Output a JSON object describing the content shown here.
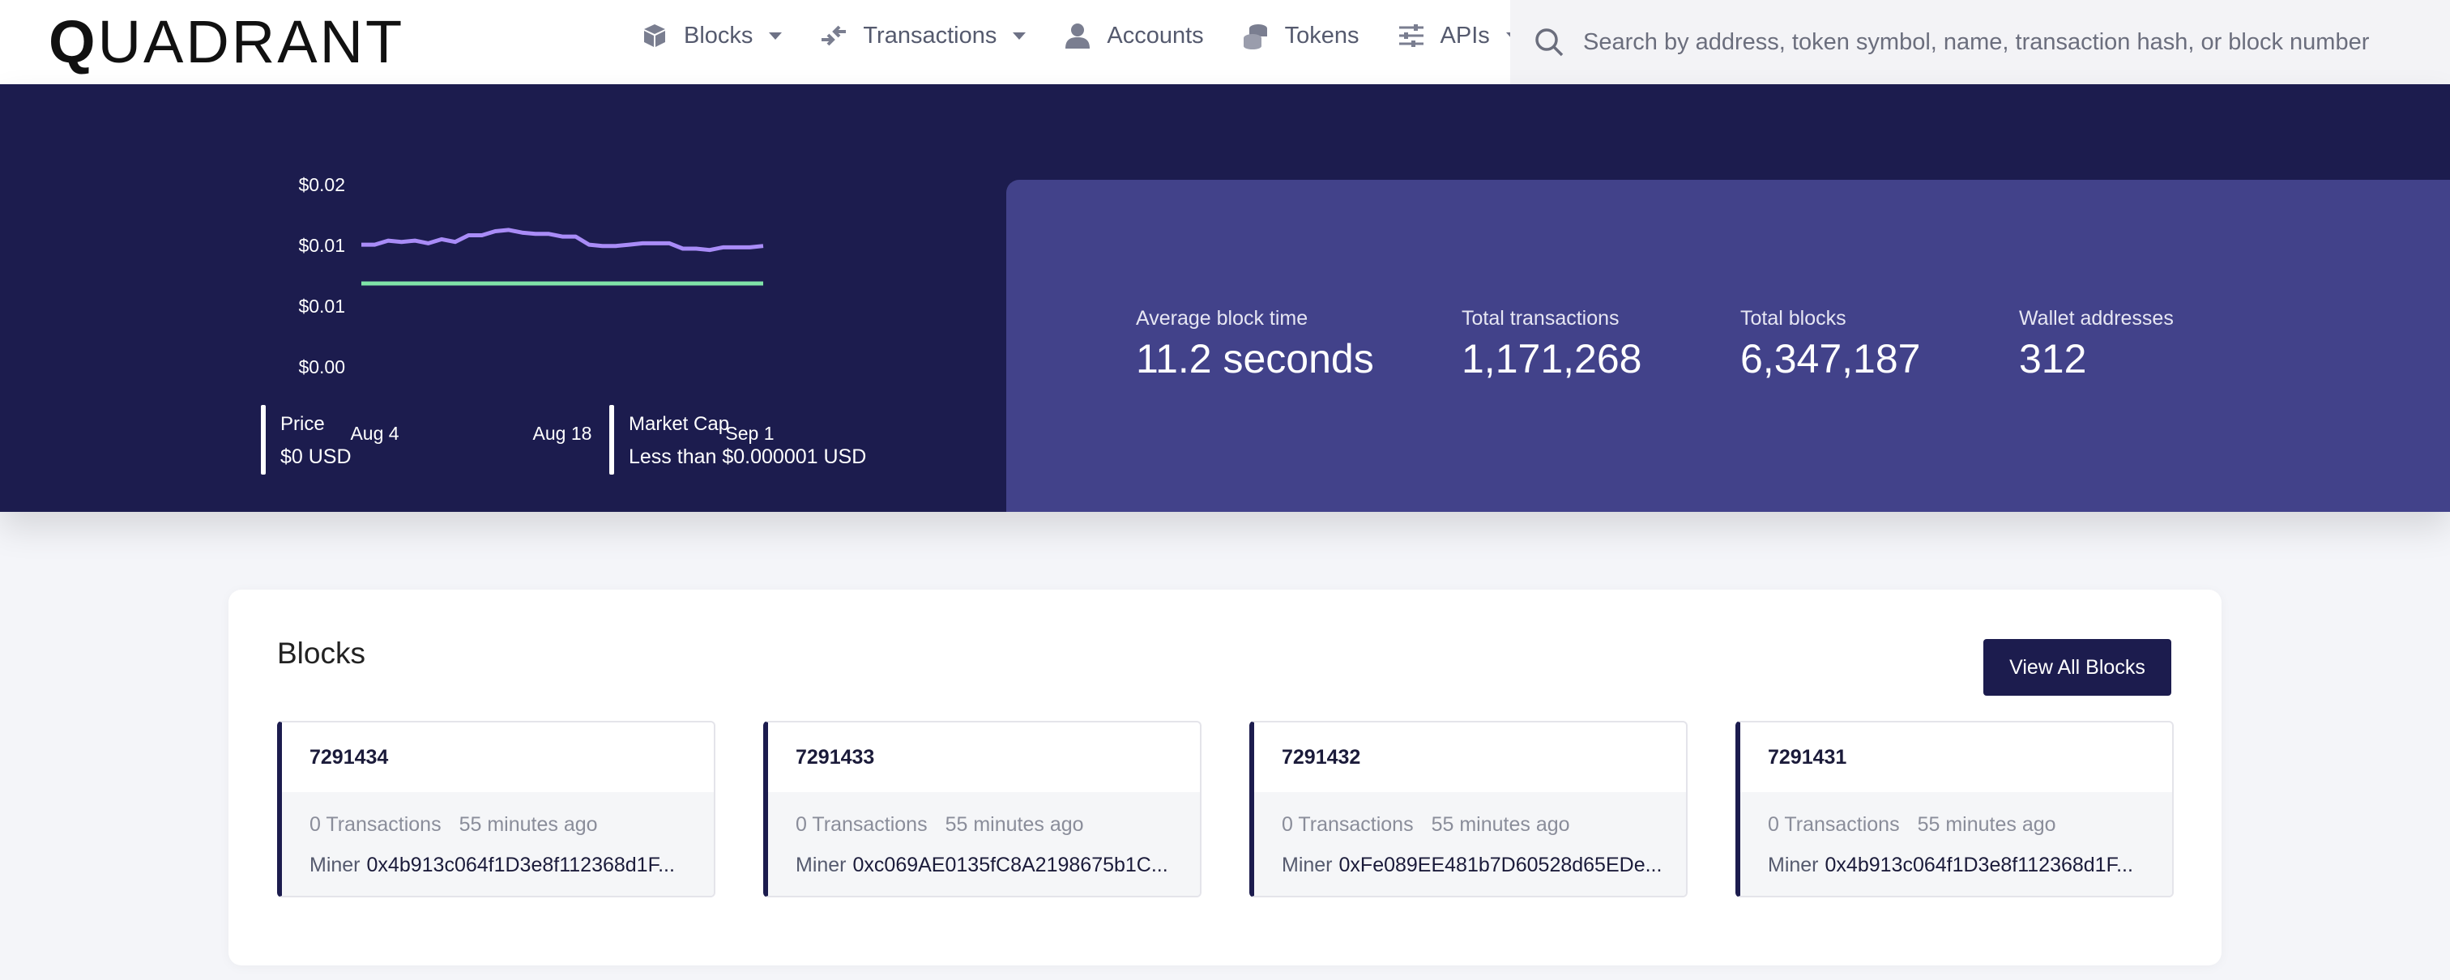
{
  "header": {
    "logo": {
      "first": "Q",
      "rest": "UADRANT"
    },
    "nav": [
      {
        "label": "Blocks",
        "icon": "cube-icon",
        "has_dropdown": true
      },
      {
        "label": "Transactions",
        "icon": "transfer-arrows-icon",
        "has_dropdown": true
      },
      {
        "label": "Accounts",
        "icon": "user-icon",
        "has_dropdown": false
      },
      {
        "label": "Tokens",
        "icon": "coins-icon",
        "has_dropdown": false
      },
      {
        "label": "APIs",
        "icon": "sliders-icon",
        "has_dropdown": true
      }
    ],
    "search": {
      "placeholder": "Search by address, token symbol, name, transaction hash, or block number",
      "value": ""
    }
  },
  "hero": {
    "price": {
      "label": "Price",
      "value": "$0 USD"
    },
    "market_cap": {
      "label": "Market Cap",
      "value": "Less than $0.000001 USD"
    },
    "stats": [
      {
        "label": "Average block time",
        "value": "11.2 seconds"
      },
      {
        "label": "Total transactions",
        "value": "1,171,268"
      },
      {
        "label": "Total blocks",
        "value": "6,347,187"
      },
      {
        "label": "Wallet addresses",
        "value": "312"
      }
    ]
  },
  "chart_data": {
    "type": "line",
    "title": "",
    "xlabel": "",
    "ylabel": "",
    "x_ticks": [
      "Aug 4",
      "Aug 18",
      "Sep 1"
    ],
    "y_ticks": [
      "$0.02",
      "$0.01",
      "$0.01",
      "$0.00"
    ],
    "ylim": [
      0,
      0.015
    ],
    "x": [
      "Aug 3",
      "Aug 4",
      "Aug 5",
      "Aug 6",
      "Aug 7",
      "Aug 8",
      "Aug 9",
      "Aug 10",
      "Aug 11",
      "Aug 12",
      "Aug 13",
      "Aug 14",
      "Aug 15",
      "Aug 16",
      "Aug 17",
      "Aug 18",
      "Aug 19",
      "Aug 20",
      "Aug 21",
      "Aug 22",
      "Aug 23",
      "Aug 24",
      "Aug 25",
      "Aug 26",
      "Aug 27",
      "Aug 28",
      "Aug 29",
      "Aug 30",
      "Aug 31",
      "Sep 1",
      "Sep 2"
    ],
    "series": [
      {
        "color": "#a98cf7",
        "values": [
          0.0104,
          0.0104,
          0.0107,
          0.0106,
          0.0107,
          0.0105,
          0.0108,
          0.0106,
          0.0111,
          0.0111,
          0.0114,
          0.0115,
          0.0113,
          0.0112,
          0.0112,
          0.011,
          0.011,
          0.0104,
          0.0103,
          0.0103,
          0.0104,
          0.0105,
          0.0105,
          0.0105,
          0.0101,
          0.0101,
          0.01,
          0.0102,
          0.0102,
          0.0102,
          0.0103
        ]
      },
      {
        "color": "#7fe3a8",
        "values": [
          0.0075,
          0.0075,
          0.0075,
          0.0075,
          0.0075,
          0.0075,
          0.0075,
          0.0075,
          0.0075,
          0.0075,
          0.0075,
          0.0075,
          0.0075,
          0.0075,
          0.0075,
          0.0075,
          0.0075,
          0.0075,
          0.0075,
          0.0075,
          0.0075,
          0.0075,
          0.0075,
          0.0075,
          0.0075,
          0.0075,
          0.0075,
          0.0075,
          0.0075,
          0.0075,
          0.0075
        ]
      }
    ],
    "grid": false,
    "legend": "none"
  },
  "blocks": {
    "title": "Blocks",
    "view_all_label": "View All Blocks",
    "miner_label": "Miner",
    "items": [
      {
        "number": "7291434",
        "transactions": "0 Transactions",
        "age": "55 minutes ago",
        "miner": "0x4b913c064f1D3e8f112368d1F..."
      },
      {
        "number": "7291433",
        "transactions": "0 Transactions",
        "age": "55 minutes ago",
        "miner": "0xc069AE0135fC8A2198675b1C..."
      },
      {
        "number": "7291432",
        "transactions": "0 Transactions",
        "age": "55 minutes ago",
        "miner": "0xFe089EE481b7D60528d65EDe..."
      },
      {
        "number": "7291431",
        "transactions": "0 Transactions",
        "age": "55 minutes ago",
        "miner": "0x4b913c064f1D3e8f112368d1F..."
      }
    ]
  },
  "colors": {
    "primary": "#1c1c4e",
    "stats_panel": "#42428a",
    "price_line": "#a98cf7",
    "market_line": "#7fe3a8"
  }
}
